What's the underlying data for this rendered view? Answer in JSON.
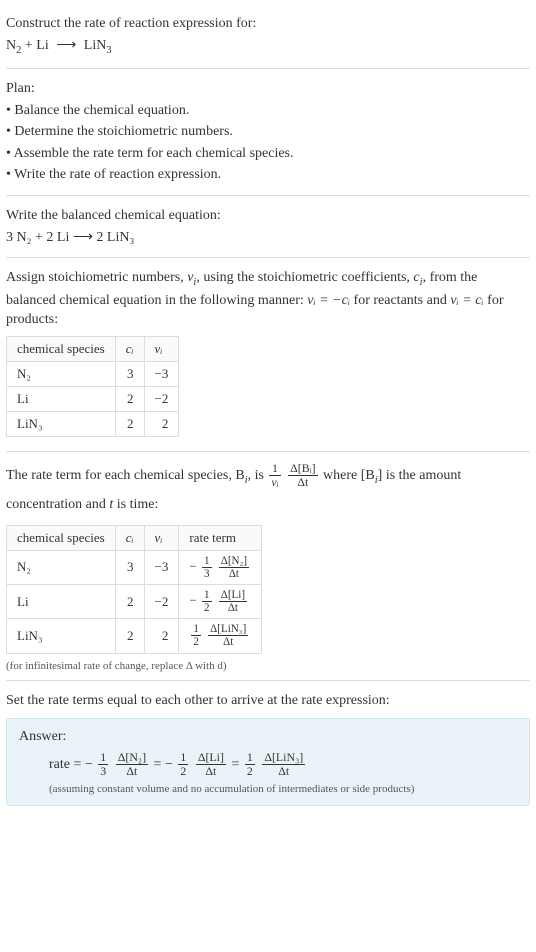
{
  "intro": {
    "prompt": "Construct the rate of reaction expression for:",
    "equation_lhs": "N",
    "equation_lhs_sub": "2",
    "equation_plus": " + Li ",
    "arrow": "⟶",
    "equation_rhs": " LiN",
    "equation_rhs_sub": "3"
  },
  "plan": {
    "title": "Plan:",
    "items": [
      "• Balance the chemical equation.",
      "• Determine the stoichiometric numbers.",
      "• Assemble the rate term for each chemical species.",
      "• Write the rate of reaction expression."
    ]
  },
  "balanced": {
    "title": "Write the balanced chemical equation:",
    "eq": "3 N₂ + 2 Li ⟶ 2 LiN₃"
  },
  "stoich": {
    "text1": "Assign stoichiometric numbers, ",
    "nu_i": "ν",
    "nu_i_sub": "i",
    "text2": ", using the stoichiometric coefficients, ",
    "c_i": "c",
    "c_i_sub": "i",
    "text3": ", from the balanced chemical equation in the following manner: ",
    "rel1": "νᵢ = −cᵢ",
    "text4": " for reactants and ",
    "rel2": "νᵢ = cᵢ",
    "text5": " for products:",
    "table": {
      "headers": [
        "chemical species",
        "cᵢ",
        "νᵢ"
      ],
      "rows": [
        {
          "species": "N₂",
          "c": "3",
          "nu": "−3"
        },
        {
          "species": "Li",
          "c": "2",
          "nu": "−2"
        },
        {
          "species": "LiN₃",
          "c": "2",
          "nu": "2"
        }
      ]
    }
  },
  "rateterm": {
    "text1": "The rate term for each chemical species, B",
    "sub_i": "i",
    "text2": ", is ",
    "frac1_num": "1",
    "frac1_den": "νᵢ",
    "frac2_num": "Δ[Bᵢ]",
    "frac2_den": "Δt",
    "text3": " where [B",
    "text4": "] is the amount concentration and ",
    "t": "t",
    "text5": " is time:",
    "table": {
      "headers": [
        "chemical species",
        "cᵢ",
        "νᵢ",
        "rate term"
      ],
      "rows": [
        {
          "species": "N₂",
          "c": "3",
          "nu": "−3",
          "sign": "−",
          "coef_num": "1",
          "coef_den": "3",
          "d_num": "Δ[N₂]",
          "d_den": "Δt"
        },
        {
          "species": "Li",
          "c": "2",
          "nu": "−2",
          "sign": "−",
          "coef_num": "1",
          "coef_den": "2",
          "d_num": "Δ[Li]",
          "d_den": "Δt"
        },
        {
          "species": "LiN₃",
          "c": "2",
          "nu": "2",
          "sign": "",
          "coef_num": "1",
          "coef_den": "2",
          "d_num": "Δ[LiN₃]",
          "d_den": "Δt"
        }
      ]
    },
    "footnote": "(for infinitesimal rate of change, replace Δ with d)"
  },
  "final": {
    "title": "Set the rate terms equal to each other to arrive at the rate expression:"
  },
  "answer": {
    "label": "Answer:",
    "prefix": "rate = ",
    "terms": [
      {
        "sign": "−",
        "coef_num": "1",
        "coef_den": "3",
        "d_num": "Δ[N₂]",
        "d_den": "Δt",
        "after": " = "
      },
      {
        "sign": "−",
        "coef_num": "1",
        "coef_den": "2",
        "d_num": "Δ[Li]",
        "d_den": "Δt",
        "after": " = "
      },
      {
        "sign": "",
        "coef_num": "1",
        "coef_den": "2",
        "d_num": "Δ[LiN₃]",
        "d_den": "Δt",
        "after": ""
      }
    ],
    "note": "(assuming constant volume and no accumulation of intermediates or side products)"
  },
  "chart_data": {
    "type": "table",
    "tables": [
      {
        "title": "Stoichiometric numbers",
        "columns": [
          "chemical species",
          "c_i",
          "nu_i"
        ],
        "rows": [
          [
            "N2",
            3,
            -3
          ],
          [
            "Li",
            2,
            -2
          ],
          [
            "LiN3",
            2,
            2
          ]
        ]
      },
      {
        "title": "Rate terms",
        "columns": [
          "chemical species",
          "c_i",
          "nu_i",
          "rate term"
        ],
        "rows": [
          [
            "N2",
            3,
            -3,
            "-(1/3) Δ[N2]/Δt"
          ],
          [
            "Li",
            2,
            -2,
            "-(1/2) Δ[Li]/Δt"
          ],
          [
            "LiN3",
            2,
            2,
            "(1/2) Δ[LiN3]/Δt"
          ]
        ]
      }
    ],
    "balanced_equation": "3 N2 + 2 Li -> 2 LiN3",
    "rate_expression": "rate = -(1/3) Δ[N2]/Δt = -(1/2) Δ[Li]/Δt = (1/2) Δ[LiN3]/Δt"
  }
}
